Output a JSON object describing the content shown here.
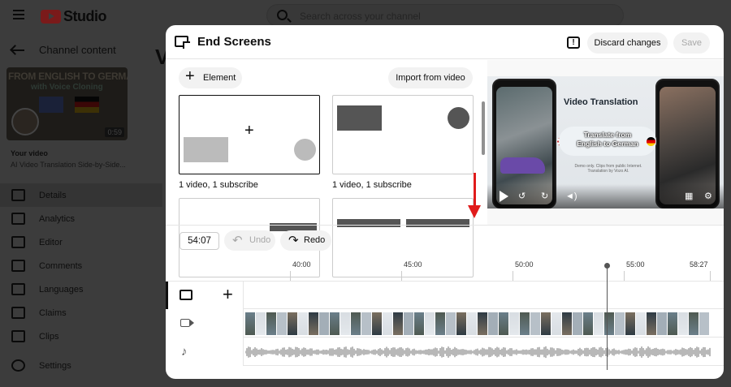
{
  "app": {
    "title": "Studio",
    "search_placeholder": "Search across your channel"
  },
  "sidebar": {
    "back_label": "Channel content",
    "thumbnail": {
      "title": "FROM ENGLISH TO GERMAN",
      "subtitle": "with Voice Cloning",
      "duration": "0:59"
    },
    "your_video_label": "Your video",
    "video_name": "AI Video Translation Side-by-Side...",
    "items": [
      {
        "label": "Details",
        "icon": "pencil-icon",
        "active": true
      },
      {
        "label": "Analytics",
        "icon": "chart-icon"
      },
      {
        "label": "Editor",
        "icon": "film-icon"
      },
      {
        "label": "Comments",
        "icon": "comment-icon"
      },
      {
        "label": "Languages",
        "icon": "subtitles-icon"
      },
      {
        "label": "Claims",
        "icon": "copyright-icon"
      },
      {
        "label": "Clips",
        "icon": "scissors-icon"
      }
    ],
    "settings_label": "Settings"
  },
  "background": {
    "heading_letter": "V"
  },
  "modal": {
    "title": "End Screens",
    "discard_label": "Discard changes",
    "save_label": "Save",
    "feedback_glyph": "!",
    "element_label": "Element",
    "import_label": "Import from video",
    "templates": [
      {
        "caption": "1 video, 1 subscribe"
      },
      {
        "caption": "1 video, 1 subscribe"
      }
    ],
    "preview": {
      "title": "Video Translation",
      "pill_line1": "Translate from",
      "pill_line2": "English to German",
      "note": "Demo only. Clips from public Internet. Translation by Vozo AI."
    },
    "time": "54:07",
    "undo_label": "Undo",
    "redo_label": "Redo",
    "ruler_ticks": [
      "40:00",
      "45:00",
      "50:00",
      "55:00",
      "58:27"
    ]
  }
}
